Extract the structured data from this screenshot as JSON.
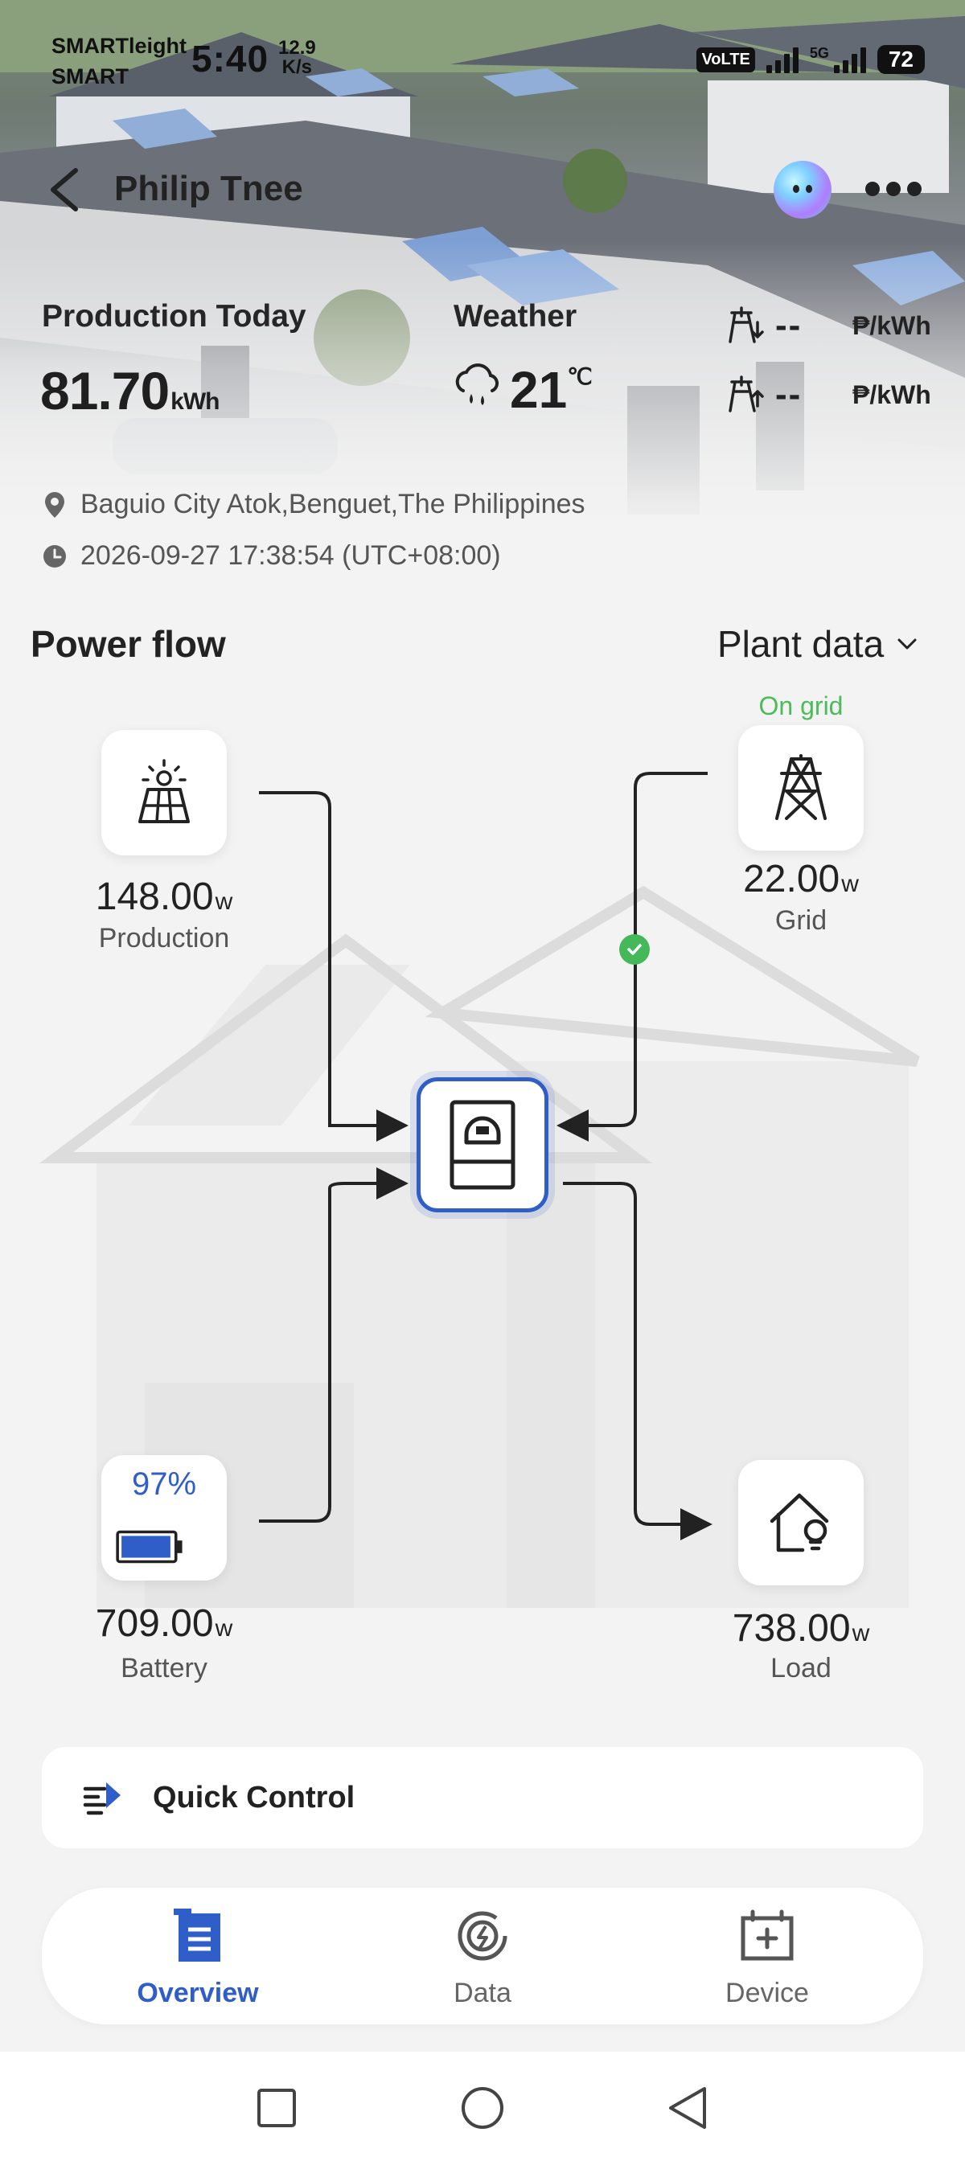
{
  "status_bar": {
    "carrier": [
      "SMARTleight",
      "SMART"
    ],
    "time": "5:40",
    "speed": [
      "12.9",
      "K/s"
    ],
    "volte": "VoLTE",
    "network": "5G",
    "battery": "72"
  },
  "header": {
    "plant_name": "Philip Tnee"
  },
  "stats": {
    "production_label": "Production Today",
    "production_value": "81.70",
    "production_unit": "kWh",
    "weather_label": "Weather",
    "temperature": "21",
    "temperature_unit": "℃",
    "buy_price": "--",
    "sell_price": "--",
    "price_unit": "₱/kWh"
  },
  "location": "Baguio City Atok,Benguet,The Philippines",
  "datetime": "2026-09-27 17:38:54 (UTC+08:00)",
  "power_flow": {
    "title": "Power flow",
    "selector": "Plant data",
    "grid_status": "On grid",
    "production": {
      "value": "148.00",
      "unit": "w",
      "label": "Production"
    },
    "grid": {
      "value": "22.00",
      "unit": "w",
      "label": "Grid"
    },
    "battery": {
      "value": "709.00",
      "unit": "w",
      "label": "Battery",
      "soc": "97%",
      "soc_level": 0.97
    },
    "load": {
      "value": "738.00",
      "unit": "w",
      "label": "Load"
    }
  },
  "quick_control": {
    "label": "Quick Control"
  },
  "bottom_nav": {
    "tabs": [
      {
        "label": "Overview",
        "icon": "overview-icon",
        "active": true
      },
      {
        "label": "Data",
        "icon": "data-icon",
        "active": false
      },
      {
        "label": "Device",
        "icon": "device-icon",
        "active": false
      }
    ]
  },
  "colors": {
    "accent": "#2f5ec9",
    "on_grid": "#4cbb5a",
    "background": "#f3f3f3"
  }
}
